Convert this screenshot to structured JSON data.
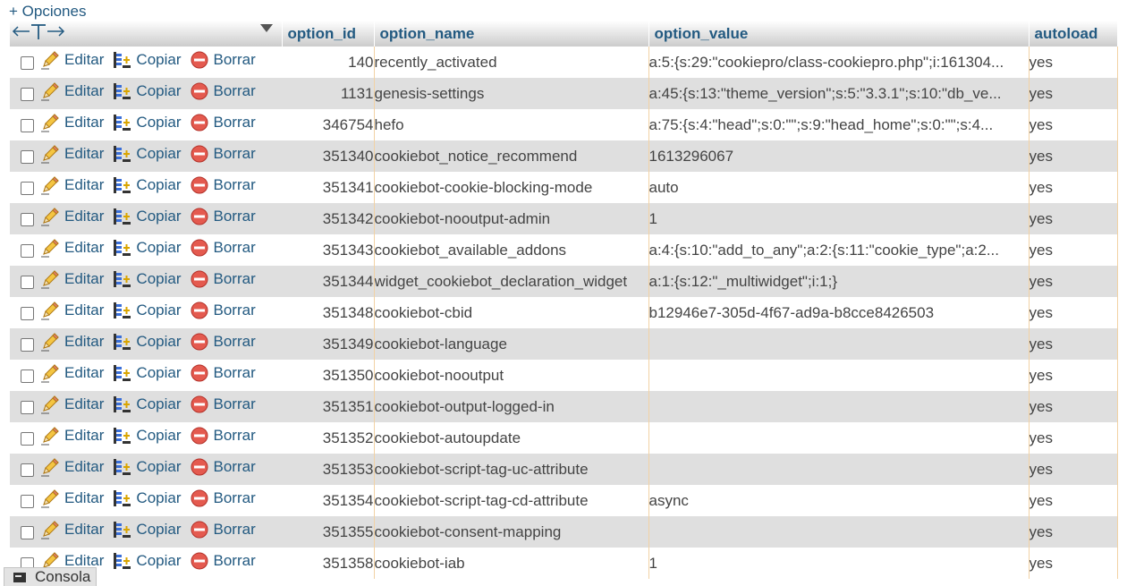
{
  "options_link": "+ Opciones",
  "columns": {
    "option_id": "option_id",
    "option_name": "option_name",
    "option_value": "option_value",
    "autoload": "autoload"
  },
  "actions": {
    "edit": "Editar",
    "copy": "Copiar",
    "delete": "Borrar"
  },
  "rows": [
    {
      "option_id": "140",
      "option_name": "recently_activated",
      "option_value": "a:5:{s:29:\"cookiepro/class-cookiepro.php\";i:161304...",
      "autoload": "yes"
    },
    {
      "option_id": "1131",
      "option_name": "genesis-settings",
      "option_value": "a:45:{s:13:\"theme_version\";s:5:\"3.3.1\";s:10:\"db_ve...",
      "autoload": "yes"
    },
    {
      "option_id": "346754",
      "option_name": "hefo",
      "option_value": "a:75:{s:4:\"head\";s:0:\"\";s:9:\"head_home\";s:0:\"\";s:4...",
      "autoload": "yes"
    },
    {
      "option_id": "351340",
      "option_name": "cookiebot_notice_recommend",
      "option_value": "1613296067",
      "autoload": "yes"
    },
    {
      "option_id": "351341",
      "option_name": "cookiebot-cookie-blocking-mode",
      "option_value": "auto",
      "autoload": "yes"
    },
    {
      "option_id": "351342",
      "option_name": "cookiebot-nooutput-admin",
      "option_value": "1",
      "autoload": "yes"
    },
    {
      "option_id": "351343",
      "option_name": "cookiebot_available_addons",
      "option_value": "a:4:{s:10:\"add_to_any\";a:2:{s:11:\"cookie_type\";a:2...",
      "autoload": "yes"
    },
    {
      "option_id": "351344",
      "option_name": "widget_cookiebot_declaration_widget",
      "option_value": "a:1:{s:12:\"_multiwidget\";i:1;}",
      "autoload": "yes"
    },
    {
      "option_id": "351348",
      "option_name": "cookiebot-cbid",
      "option_value": "b12946e7-305d-4f67-ad9a-b8cce8426503",
      "autoload": "yes"
    },
    {
      "option_id": "351349",
      "option_name": "cookiebot-language",
      "option_value": "",
      "autoload": "yes"
    },
    {
      "option_id": "351350",
      "option_name": "cookiebot-nooutput",
      "option_value": "",
      "autoload": "yes"
    },
    {
      "option_id": "351351",
      "option_name": "cookiebot-output-logged-in",
      "option_value": "",
      "autoload": "yes"
    },
    {
      "option_id": "351352",
      "option_name": "cookiebot-autoupdate",
      "option_value": "",
      "autoload": "yes"
    },
    {
      "option_id": "351353",
      "option_name": "cookiebot-script-tag-uc-attribute",
      "option_value": "",
      "autoload": "yes"
    },
    {
      "option_id": "351354",
      "option_name": "cookiebot-script-tag-cd-attribute",
      "option_value": "async",
      "autoload": "yes"
    },
    {
      "option_id": "351355",
      "option_name": "cookiebot-consent-mapping",
      "option_value": "",
      "autoload": "yes"
    },
    {
      "option_id": "351358",
      "option_name": "cookiebot-iab",
      "option_value": "1",
      "autoload": "yes"
    }
  ],
  "console_label": "Consola",
  "colors": {
    "link": "#235a81",
    "row_alt": "#dfdfdf",
    "cell_border": "#f2d2a4"
  },
  "icons": {
    "edit": "pencil-icon",
    "copy": "copy-insert-icon",
    "delete": "delete-circle-icon",
    "header": "left-right-arrows-icon",
    "console": "terminal-icon"
  }
}
